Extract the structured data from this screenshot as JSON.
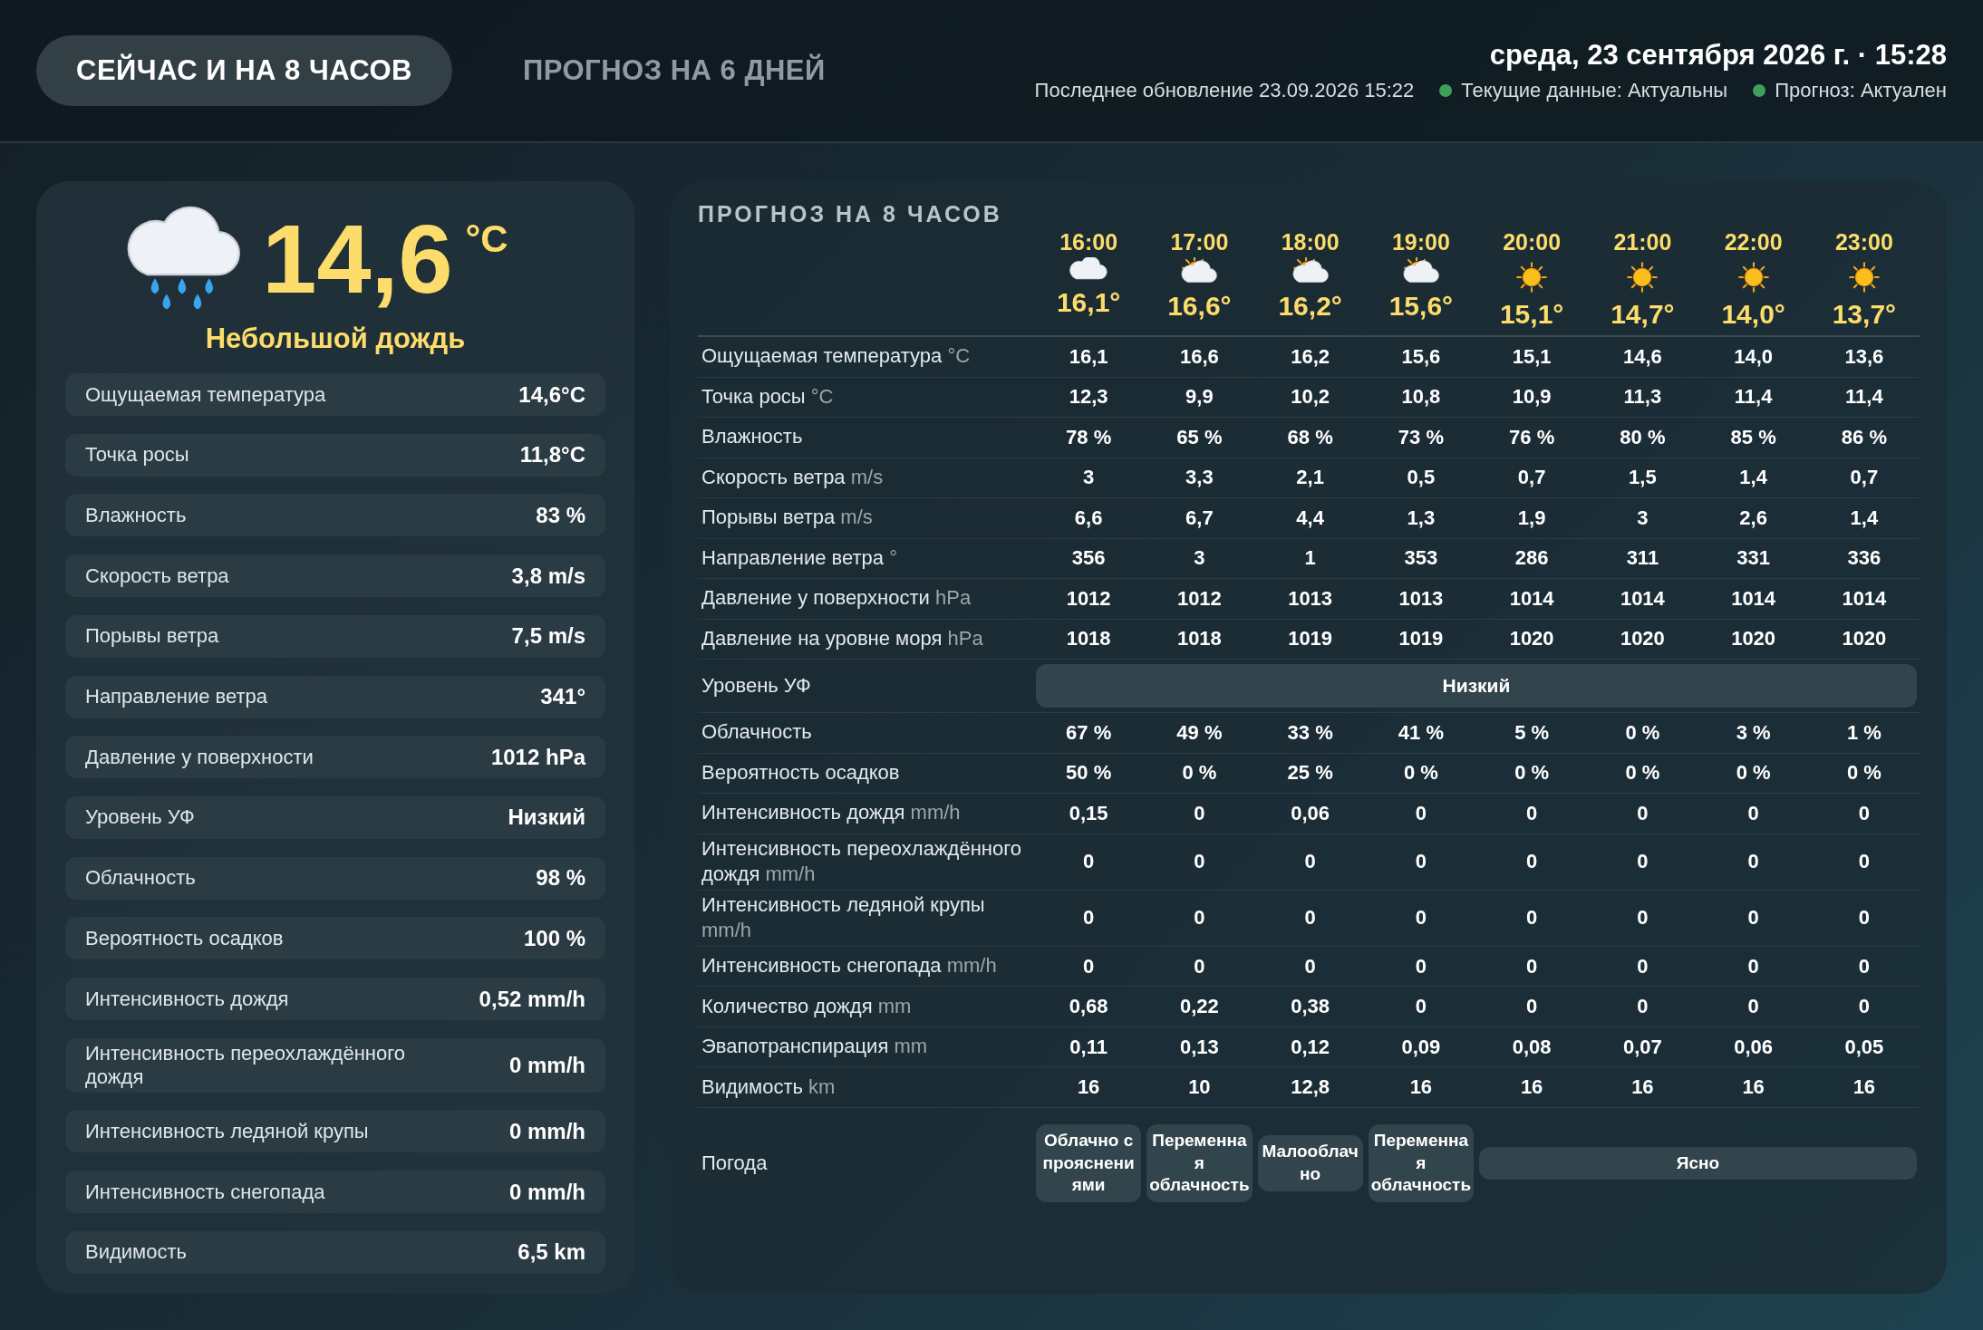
{
  "tabs": [
    {
      "label": "СЕЙЧАС И НА 8 ЧАСОВ",
      "selected": true
    },
    {
      "label": "ПРОГНОЗ НА 6 ДНЕЙ",
      "selected": false
    }
  ],
  "header": {
    "datetime": "среда, 23 сентября 2026 г. · 15:28",
    "last_update": "Последнее обновление 23.09.2026 15:22",
    "statuses": [
      {
        "label": "Текущие данные: Актуальны",
        "color": "#3f9e57"
      },
      {
        "label": "Прогноз: Актуален",
        "color": "#3f9e57"
      }
    ]
  },
  "current": {
    "kind": "rain",
    "temperature": "14,6",
    "unit": "°C",
    "condition": "Небольшой дождь",
    "details": [
      {
        "label": "Ощущаемая температура",
        "value": "14,6°C"
      },
      {
        "label": "Точка росы",
        "value": "11,8°C"
      },
      {
        "label": "Влажность",
        "value": "83 %"
      },
      {
        "label": "Скорость ветра",
        "value": "3,8 m/s"
      },
      {
        "label": "Порывы ветра",
        "value": "7,5 m/s"
      },
      {
        "label": "Направление ветра",
        "value": "341°"
      },
      {
        "label": "Давление у поверхности",
        "value": "1012 hPa"
      },
      {
        "label": "Уровень УФ",
        "value": "Низкий"
      },
      {
        "label": "Облачность",
        "value": "98 %"
      },
      {
        "label": "Вероятность осадков",
        "value": "100 %"
      },
      {
        "label": "Интенсивность дождя",
        "value": "0,52 mm/h"
      },
      {
        "label": "Интенсивность переохлаждённого дождя",
        "value": "0 mm/h"
      },
      {
        "label": "Интенсивность ледяной крупы",
        "value": "0 mm/h"
      },
      {
        "label": "Интенсивность снегопада",
        "value": "0 mm/h"
      },
      {
        "label": "Видимость",
        "value": "6,5 km"
      }
    ]
  },
  "forecast": {
    "title": "ПРОГНОЗ НА 8 ЧАСОВ",
    "hours": [
      {
        "time": "16:00",
        "kind": "cloud",
        "temperature": "16,1°"
      },
      {
        "time": "17:00",
        "kind": "partly",
        "temperature": "16,6°"
      },
      {
        "time": "18:00",
        "kind": "partly",
        "temperature": "16,2°"
      },
      {
        "time": "19:00",
        "kind": "partly",
        "temperature": "15,6°"
      },
      {
        "time": "20:00",
        "kind": "sun",
        "temperature": "15,1°"
      },
      {
        "time": "21:00",
        "kind": "sun",
        "temperature": "14,7°"
      },
      {
        "time": "22:00",
        "kind": "sun",
        "temperature": "14,0°"
      },
      {
        "time": "23:00",
        "kind": "sun",
        "temperature": "13,7°"
      }
    ],
    "rows": [
      {
        "kind": "values",
        "label": "Ощущаемая температура",
        "unit": "°C",
        "values": [
          "16,1",
          "16,6",
          "16,2",
          "15,6",
          "15,1",
          "14,6",
          "14,0",
          "13,6"
        ]
      },
      {
        "kind": "values",
        "label": "Точка росы",
        "unit": "°C",
        "values": [
          "12,3",
          "9,9",
          "10,2",
          "10,8",
          "10,9",
          "11,3",
          "11,4",
          "11,4"
        ]
      },
      {
        "kind": "values",
        "label": "Влажность",
        "values": [
          "78 %",
          "65 %",
          "68 %",
          "73 %",
          "76 %",
          "80 %",
          "85 %",
          "86 %"
        ]
      },
      {
        "kind": "values",
        "label": "Скорость ветра",
        "unit": "m/s",
        "values": [
          "3",
          "3,3",
          "2,1",
          "0,5",
          "0,7",
          "1,5",
          "1,4",
          "0,7"
        ]
      },
      {
        "kind": "values",
        "label": "Порывы ветра",
        "unit": "m/s",
        "values": [
          "6,6",
          "6,7",
          "4,4",
          "1,3",
          "1,9",
          "3",
          "2,6",
          "1,4"
        ]
      },
      {
        "kind": "values",
        "label": "Направление ветра",
        "unit": "°",
        "values": [
          "356",
          "3",
          "1",
          "353",
          "286",
          "311",
          "331",
          "336"
        ]
      },
      {
        "kind": "values",
        "label": "Давление у поверхности",
        "unit": "hPa",
        "values": [
          "1012",
          "1012",
          "1013",
          "1013",
          "1014",
          "1014",
          "1014",
          "1014"
        ]
      },
      {
        "kind": "values",
        "label": "Давление на уровне моря",
        "unit": "hPa",
        "values": [
          "1018",
          "1018",
          "1019",
          "1019",
          "1020",
          "1020",
          "1020",
          "1020"
        ]
      },
      {
        "kind": "spans",
        "label": "Уровень УФ",
        "cells": [
          {
            "kind": "start",
            "text": "Низкий"
          },
          {
            "kind": "continued"
          },
          {
            "kind": "continued"
          },
          {
            "kind": "continued"
          },
          {
            "kind": "continued"
          },
          {
            "kind": "continued"
          },
          {
            "kind": "continued"
          },
          {
            "kind": "continued"
          }
        ]
      },
      {
        "kind": "values",
        "label": "Облачность",
        "values": [
          "67 %",
          "49 %",
          "33 %",
          "41 %",
          "5 %",
          "0 %",
          "3 %",
          "1 %"
        ]
      },
      {
        "kind": "values",
        "label": "Вероятность осадков",
        "values": [
          "50 %",
          "0 %",
          "25 %",
          "0 %",
          "0 %",
          "0 %",
          "0 %",
          "0 %"
        ]
      },
      {
        "kind": "values",
        "label": "Интенсивность дождя",
        "unit": "mm/h",
        "values": [
          "0,15",
          "0",
          "0,06",
          "0",
          "0",
          "0",
          "0",
          "0"
        ]
      },
      {
        "kind": "values",
        "label": "Интенсивность переохлаждённого дождя",
        "unit": "mm/h",
        "values": [
          "0",
          "0",
          "0",
          "0",
          "0",
          "0",
          "0",
          "0"
        ]
      },
      {
        "kind": "values",
        "label": "Интенсивность ледяной крупы",
        "unit": "mm/h",
        "values": [
          "0",
          "0",
          "0",
          "0",
          "0",
          "0",
          "0",
          "0"
        ]
      },
      {
        "kind": "values",
        "label": "Интенсивность снегопада",
        "unit": "mm/h",
        "values": [
          "0",
          "0",
          "0",
          "0",
          "0",
          "0",
          "0",
          "0"
        ]
      },
      {
        "kind": "values",
        "label": "Количество дождя",
        "unit": "mm",
        "values": [
          "0,68",
          "0,22",
          "0,38",
          "0",
          "0",
          "0",
          "0",
          "0"
        ]
      },
      {
        "kind": "values",
        "label": "Эвапотранспирация",
        "unit": "mm",
        "values": [
          "0,11",
          "0,13",
          "0,12",
          "0,09",
          "0,08",
          "0,07",
          "0,06",
          "0,05"
        ]
      },
      {
        "kind": "values",
        "label": "Видимость",
        "unit": "km",
        "values": [
          "16",
          "10",
          "12,8",
          "16",
          "16",
          "16",
          "16",
          "16"
        ]
      },
      {
        "kind": "spans",
        "label": "Погода",
        "cells": [
          {
            "kind": "start",
            "text": "Облачно с прояснениями"
          },
          {
            "kind": "start",
            "text": "Переменная облачность"
          },
          {
            "kind": "start",
            "text": "Малооблачно"
          },
          {
            "kind": "start",
            "text": "Переменная облачность"
          },
          {
            "kind": "start",
            "text": "Ясно"
          },
          {
            "kind": "continued"
          },
          {
            "kind": "continued"
          },
          {
            "kind": "continued"
          }
        ]
      }
    ]
  }
}
